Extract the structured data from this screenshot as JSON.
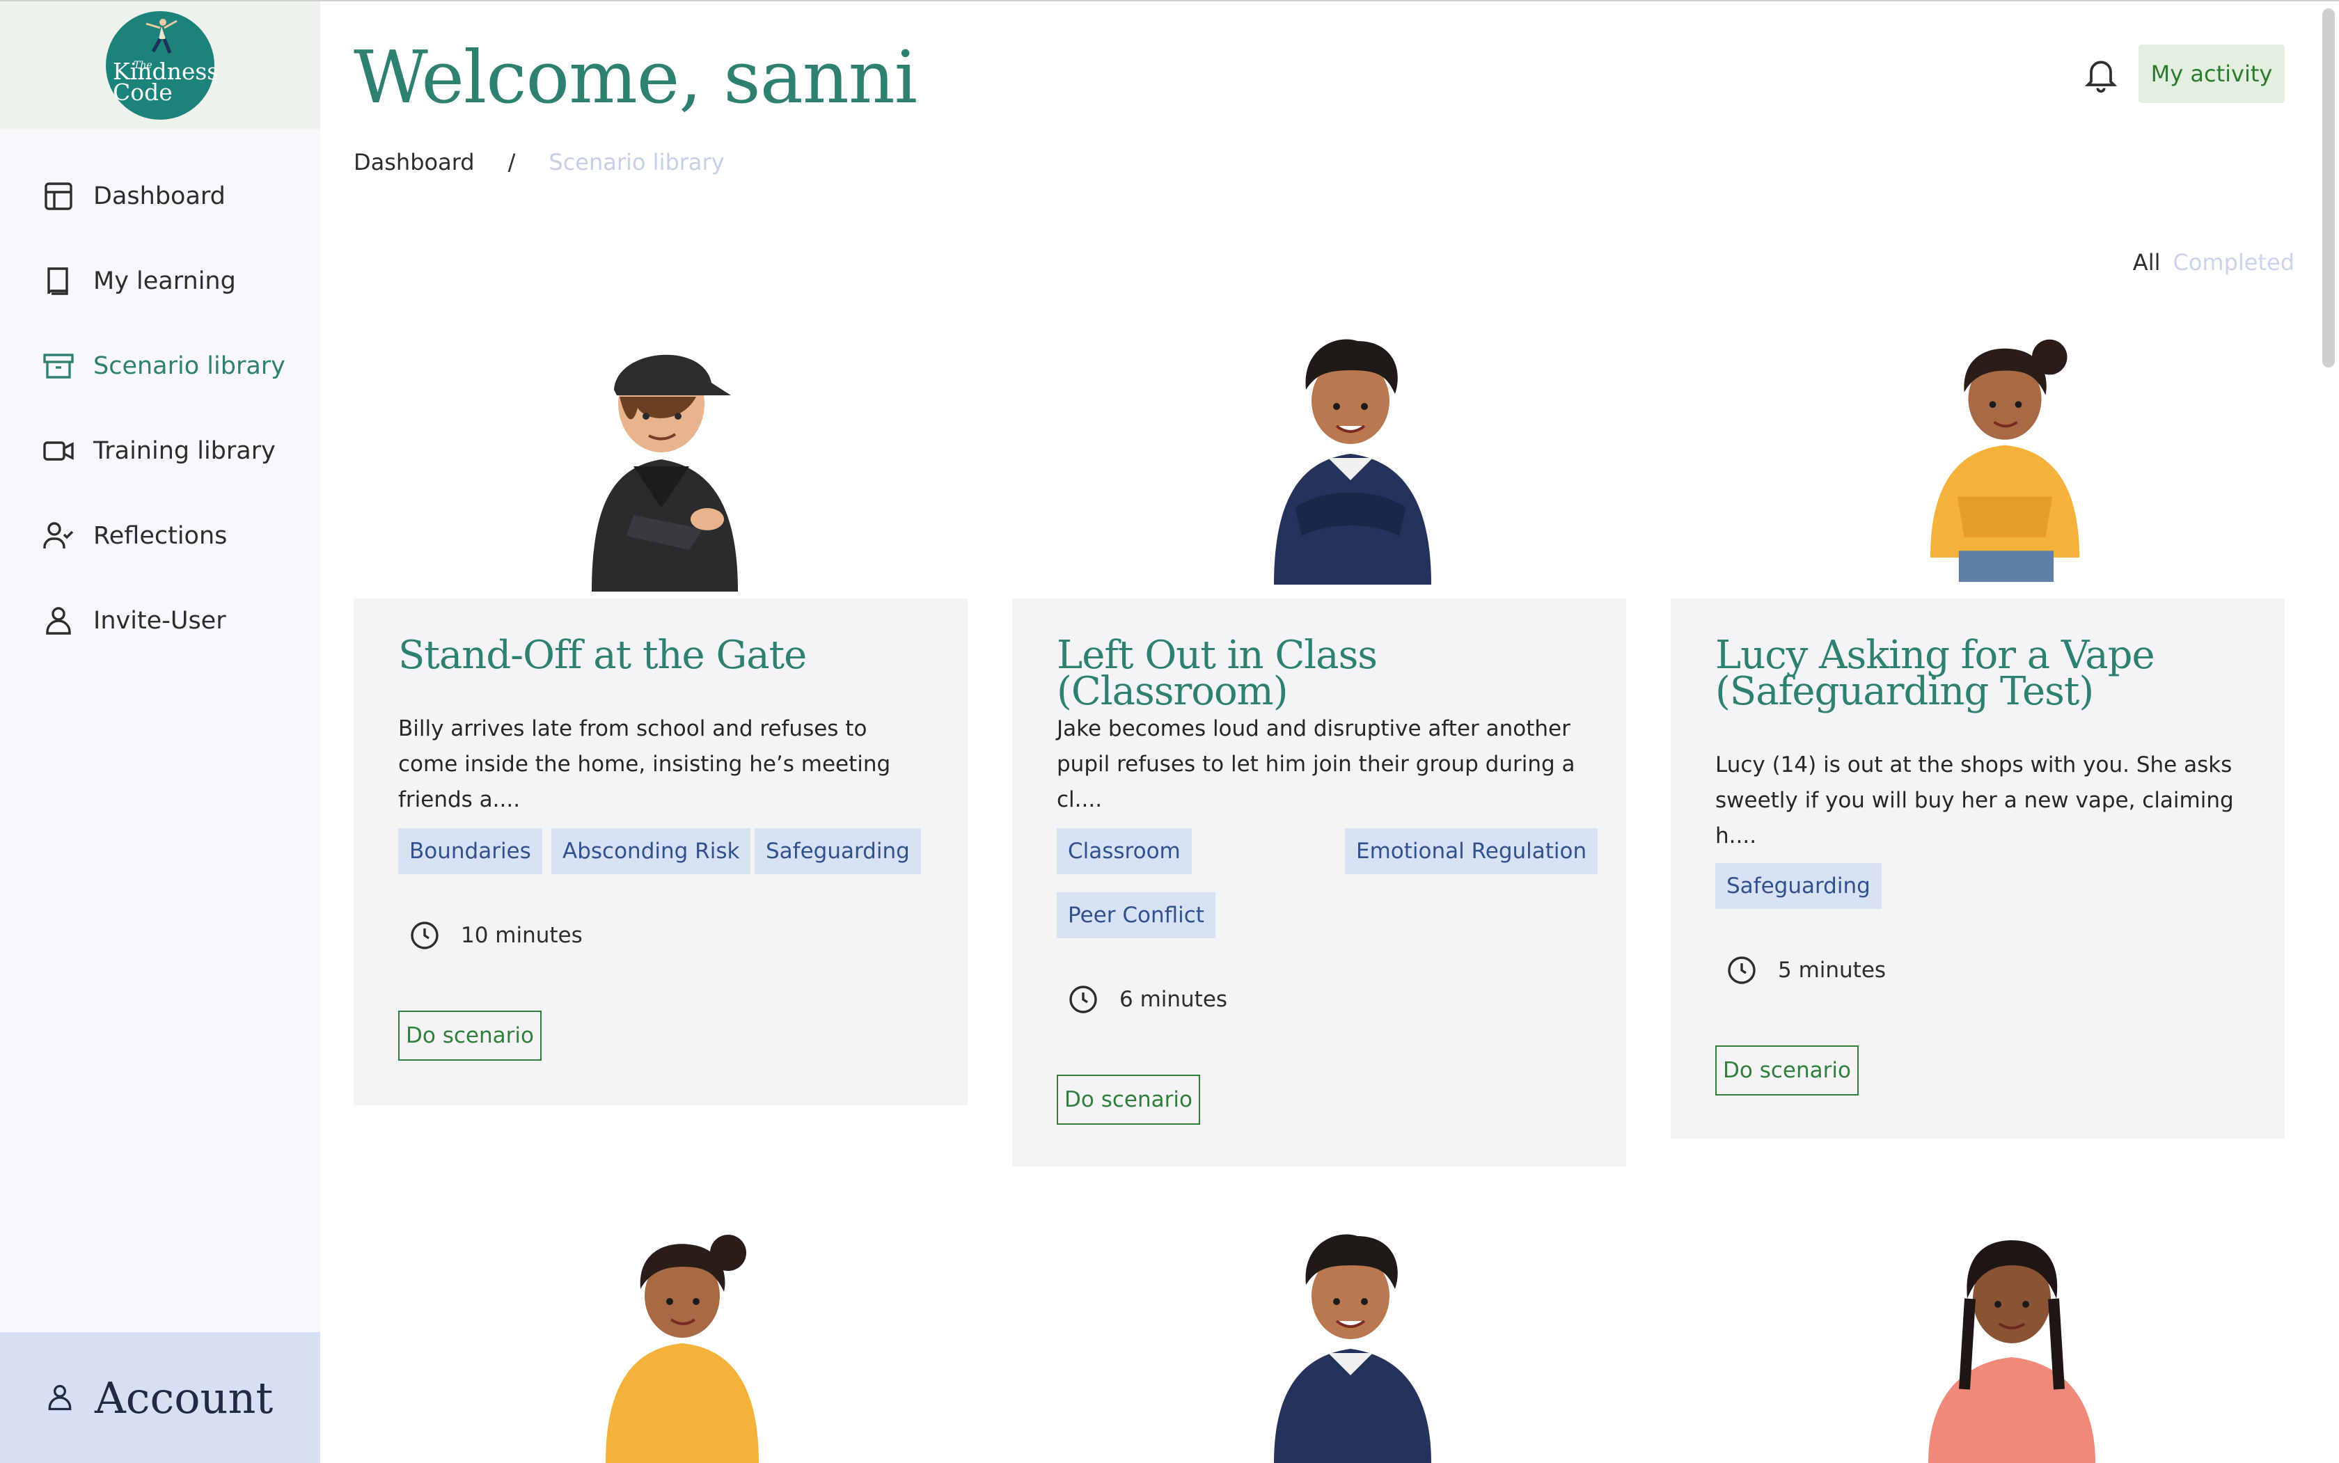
{
  "logo": {
    "small": "The",
    "line1": "Kindness",
    "line2": "Code"
  },
  "sidebar": {
    "items": [
      {
        "label": "Dashboard",
        "icon": "layout-icon"
      },
      {
        "label": "My learning",
        "icon": "book-icon"
      },
      {
        "label": "Scenario library",
        "icon": "archive-icon",
        "active": true
      },
      {
        "label": "Training library",
        "icon": "video-icon"
      },
      {
        "label": "Reflections",
        "icon": "user-check-icon"
      },
      {
        "label": "Invite-User",
        "icon": "user-icon"
      }
    ],
    "account_label": "Account"
  },
  "header": {
    "title": "Welcome, sanni",
    "activity_button": "My activity"
  },
  "breadcrumb": {
    "root": "Dashboard",
    "separator": "/",
    "current": "Scenario library"
  },
  "filters": {
    "all": "All",
    "completed": "Completed"
  },
  "cards": [
    {
      "title": "Stand-Off at the Gate",
      "description": "Billy arrives late from school and refuses to come inside the home, insisting he’s meeting friends a....",
      "tags": [
        "Boundaries",
        "Absconding Risk",
        "Safeguarding"
      ],
      "duration": "10 minutes",
      "button": "Do scenario"
    },
    {
      "title": "Left Out in Class (Classroom)",
      "description": "Jake becomes loud and disruptive after another pupil refuses to let him join their group during a cl....",
      "tags": [
        "Classroom",
        "Emotional Regulation",
        "Peer Conflict"
      ],
      "duration": "6 minutes",
      "button": "Do scenario"
    },
    {
      "title": "Lucy Asking for a Vape (Safeguarding Test)",
      "description": "Lucy (14) is out at the shops with you. She asks sweetly if you will buy her a new vape, claiming h....",
      "tags": [
        "Safeguarding"
      ],
      "duration": "5 minutes",
      "button": "Do scenario"
    }
  ],
  "colors": {
    "brand": "#2e8070",
    "tag_bg": "#d7e2f5",
    "tag_text": "#31508c",
    "button_border": "#2f7f3b",
    "card_bg": "#f4f4f7"
  }
}
